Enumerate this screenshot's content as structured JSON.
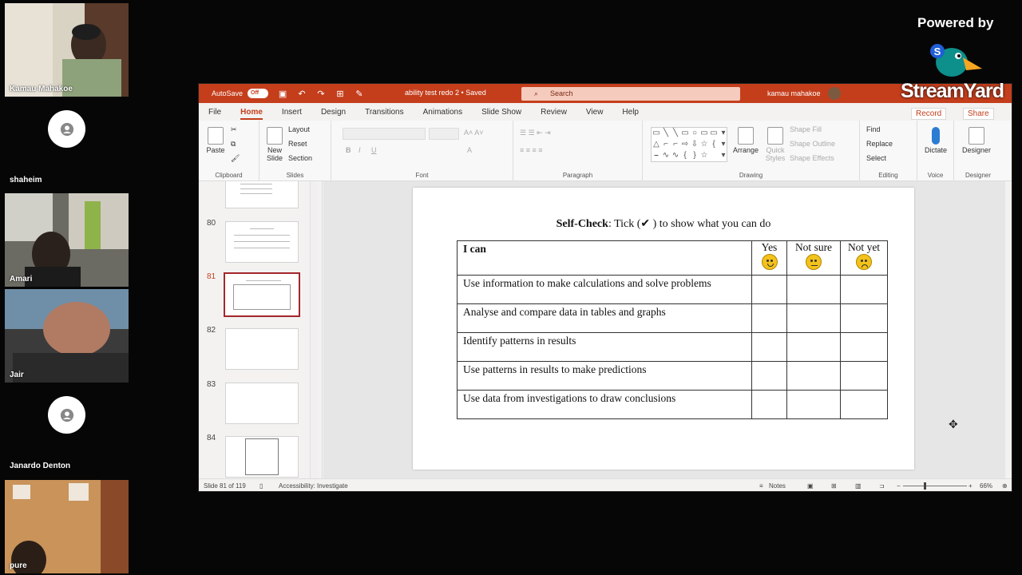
{
  "participants": [
    {
      "name": "Kamau Mahakoe",
      "has_video": true,
      "bg": "#8b7f6c"
    },
    {
      "name": "shaheim",
      "has_video": false
    },
    {
      "name": "Amari",
      "has_video": true,
      "bg": "#3b3a36"
    },
    {
      "name": "Jair",
      "has_video": true,
      "bg": "#4f6f86"
    },
    {
      "name": "Janardo Denton",
      "has_video": false
    },
    {
      "name": "pure",
      "has_video": true,
      "bg": "#c0884f"
    }
  ],
  "brand": {
    "powered_by": "Powered by",
    "name": "StreamYard"
  },
  "ppt": {
    "autosave_label": "AutoSave",
    "autosave_state": "Off",
    "doc_title": "ability test redo 2 • Saved",
    "search_placeholder": "Search",
    "user_name": "kamau mahakoe",
    "tabs": [
      "File",
      "Home",
      "Insert",
      "Design",
      "Transitions",
      "Animations",
      "Slide Show",
      "Review",
      "View",
      "Help"
    ],
    "active_tab": "Home",
    "record_label": "Record",
    "share_label": "Share",
    "ribbon": {
      "paste": "Paste",
      "new_slide": "New Slide",
      "layout": "Layout",
      "reset": "Reset",
      "section": "Section",
      "arrange": "Arrange",
      "quick_styles": "Quick Styles",
      "shape_fill": "Shape Fill",
      "shape_outline": "Shape Outline",
      "shape_effects": "Shape Effects",
      "find": "Find",
      "replace": "Replace",
      "select": "Select",
      "dictate": "Dictate",
      "designer": "Designer",
      "groups": [
        "Clipboard",
        "Slides",
        "Font",
        "Paragraph",
        "Drawing",
        "Editing",
        "Voice",
        "Designer"
      ]
    },
    "thumbnails": [
      "80",
      "81",
      "82",
      "83",
      "84"
    ],
    "selected_slide": "81",
    "slide": {
      "title_bold": "Self-Check",
      "title_rest": ": Tick (✔ ) to show what you can do",
      "header": [
        "I can",
        "Yes",
        "Not sure",
        "Not yet"
      ],
      "rows": [
        "Use information to make calculations and solve problems",
        "Analyse and compare data in tables and graphs",
        "Identify patterns in results",
        "Use patterns in results to make predictions",
        "Use data from investigations to draw conclusions"
      ]
    },
    "status": {
      "slide_info": "Slide 81 of 119",
      "accessibility": "Accessibility: Investigate",
      "notes": "Notes",
      "zoom": "66%"
    }
  }
}
